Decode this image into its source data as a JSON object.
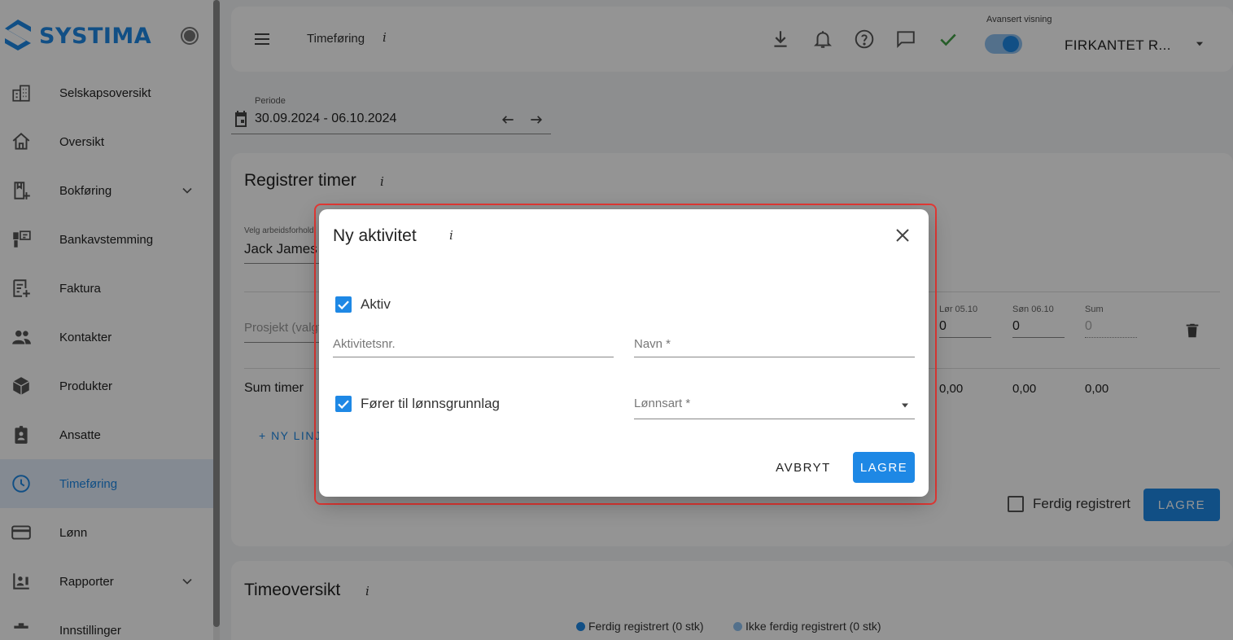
{
  "app": {
    "logo_text": "SYSTIMA"
  },
  "sidebar": {
    "items": [
      {
        "label": "Selskapsoversikt",
        "icon": "building-icon"
      },
      {
        "label": "Oversikt",
        "icon": "home-icon"
      },
      {
        "label": "Bokføring",
        "icon": "book-icon",
        "expandable": true
      },
      {
        "label": "Bankavstemming",
        "icon": "bank-icon"
      },
      {
        "label": "Faktura",
        "icon": "invoice-icon"
      },
      {
        "label": "Kontakter",
        "icon": "people-icon"
      },
      {
        "label": "Produkter",
        "icon": "box-icon"
      },
      {
        "label": "Ansatte",
        "icon": "badge-icon"
      },
      {
        "label": "Timeføring",
        "icon": "clock-icon",
        "active": true
      },
      {
        "label": "Lønn",
        "icon": "card-icon"
      },
      {
        "label": "Rapporter",
        "icon": "report-icon",
        "expandable": true
      },
      {
        "label": "Innstillinger",
        "icon": "settings-icon"
      }
    ]
  },
  "topbar": {
    "page_title": "Timeføring",
    "info": "i",
    "advanced_label": "Avansert visning",
    "advanced_on": true,
    "company": "FIRKANTET R..."
  },
  "period": {
    "label": "Periode",
    "value": "30.09.2024 - 06.10.2024"
  },
  "register": {
    "title": "Registrer timer",
    "info": "i",
    "worker_label": "Velg arbeidsforhold",
    "worker_value": "Jack James",
    "project_placeholder": "Prosjekt (valgfritt)",
    "days": [
      {
        "header": "Lør 05.10",
        "value": "0",
        "sum": "0,00"
      },
      {
        "header": "Søn 06.10",
        "value": "0",
        "sum": "0,00"
      },
      {
        "header": "Sum",
        "value": "0",
        "sum": "0,00"
      }
    ],
    "sum_label": "Sum timer",
    "new_line": "+ NY LINJE",
    "done_label": "Ferdig registrert",
    "save_label": "LAGRE"
  },
  "overview": {
    "title": "Timeoversikt",
    "info": "i",
    "legend": [
      {
        "label": "Ferdig registrert (0 stk)",
        "color": "#1e88e5"
      },
      {
        "label": "Ikke ferdig registrert (0 stk)",
        "color": "#90c2f0"
      }
    ]
  },
  "dialog": {
    "title": "Ny aktivitet",
    "info": "i",
    "aktiv_label": "Aktiv",
    "aktiv_checked": true,
    "aktivitetsnr_placeholder": "Aktivitetsnr.",
    "navn_placeholder": "Navn *",
    "forer_label": "Fører til lønnsgrunnlag",
    "forer_checked": true,
    "lonnsart_placeholder": "Lønnsart *",
    "cancel_label": "AVBRYT",
    "save_label": "LAGRE"
  },
  "colors": {
    "accent": "#1e88e5",
    "highlight": "#e53935"
  }
}
